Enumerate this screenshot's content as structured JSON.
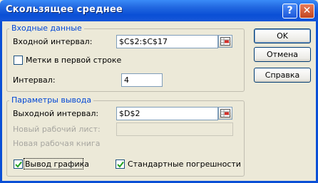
{
  "window": {
    "title": "Скользящее среднее"
  },
  "input_group": {
    "legend": "Входные данные",
    "input_range_label": "Входной интервал:",
    "input_range_value": "$C$2:$C$17",
    "labels_checkbox_label": "Метки в первой строке",
    "labels_checked": false,
    "interval_label": "Интервал:",
    "interval_value": "4"
  },
  "output_group": {
    "legend": "Параметры вывода",
    "output_range_label": "Выходной интервал:",
    "output_range_value": "$D$2",
    "new_sheet_label": "Новый рабочий лист:",
    "new_sheet_value": "",
    "new_book_label": "Новая рабочая книга",
    "chart_output_label": "Вывод графика",
    "chart_output_checked": true,
    "std_errors_label": "Стандартные погрешности",
    "std_errors_checked": true
  },
  "buttons": {
    "ok": "OK",
    "cancel": "Отмена",
    "help": "Справка"
  },
  "colors": {
    "titlebar": "#0A4FD6",
    "dialog_bg": "#ECE9D8",
    "group_legend": "#0046D5",
    "disabled_text": "#A7A6A0"
  }
}
